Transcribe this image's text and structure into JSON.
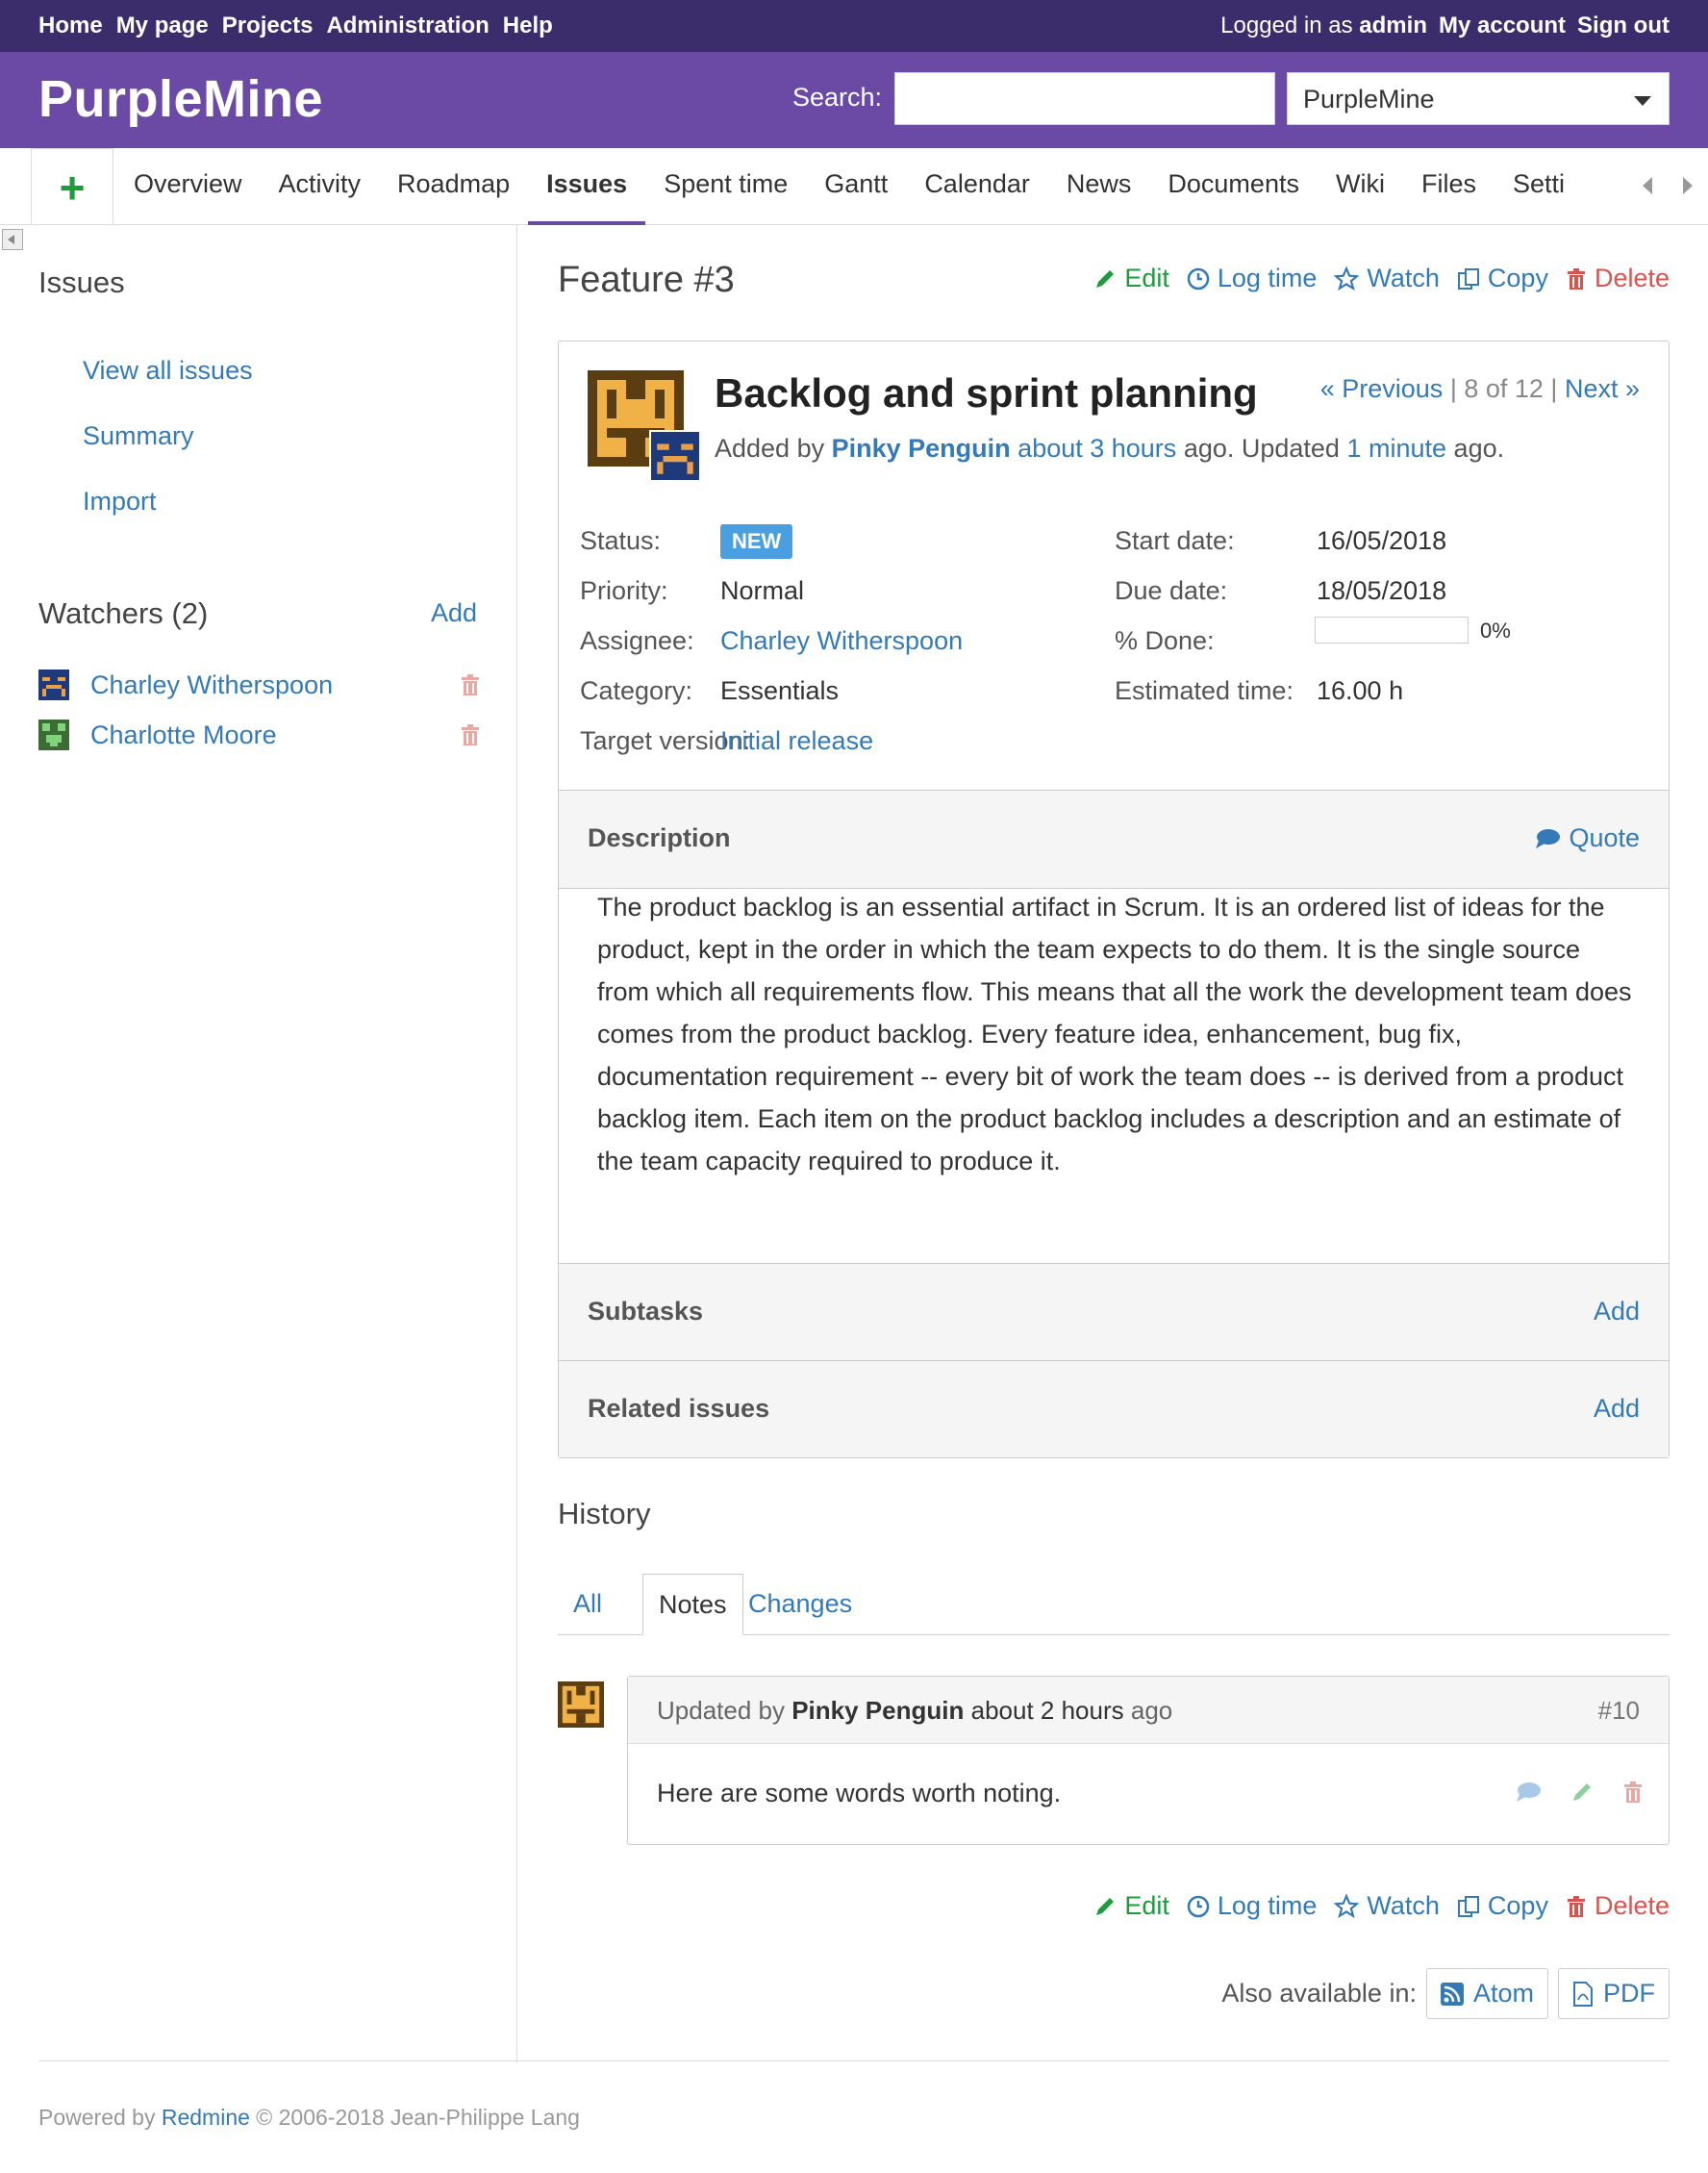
{
  "top_menu": {
    "items": [
      "Home",
      "My page",
      "Projects",
      "Administration",
      "Help"
    ],
    "logged_in_prefix": "Logged in as",
    "user": "admin",
    "my_account": "My account",
    "sign_out": "Sign out"
  },
  "header": {
    "title": "PurpleMine",
    "search_label": "Search:",
    "search_value": "",
    "project_select": "PurpleMine"
  },
  "main_menu": {
    "new_object": "+",
    "tabs": [
      "Overview",
      "Activity",
      "Roadmap",
      "Issues",
      "Spent time",
      "Gantt",
      "Calendar",
      "News",
      "Documents",
      "Wiki",
      "Files",
      "Setti"
    ],
    "selected": "Issues"
  },
  "sidebar": {
    "issues_heading": "Issues",
    "links": [
      "View all issues",
      "Summary",
      "Import"
    ],
    "watchers_heading": "Watchers (2)",
    "watchers_add": "Add",
    "watchers": [
      "Charley Witherspoon",
      "Charlotte Moore"
    ]
  },
  "issue": {
    "page_title": "Feature #3",
    "actions": {
      "edit": "Edit",
      "log_time": "Log time",
      "watch": "Watch",
      "copy": "Copy",
      "delete": "Delete"
    },
    "subject": "Backlog and sprint planning",
    "nav": {
      "previous": "« Previous",
      "position": "8 of 12",
      "next": "Next »"
    },
    "author": {
      "added_by": "Added by",
      "name": "Pinky Penguin",
      "created": "about 3 hours",
      "middle": "ago. Updated",
      "updated": "1 minute",
      "suffix": "ago."
    },
    "attributes": {
      "status_label": "Status:",
      "status": "NEW",
      "priority_label": "Priority:",
      "priority": "Normal",
      "assignee_label": "Assignee:",
      "assignee": "Charley Witherspoon",
      "category_label": "Category:",
      "category": "Essentials",
      "target_label": "Target version:",
      "target": "Initial release",
      "start_label": "Start date:",
      "start": "16/05/2018",
      "due_label": "Due date:",
      "due": "18/05/2018",
      "done_label": "% Done:",
      "done": "0%",
      "done_fraction": 0,
      "estimated_label": "Estimated time:",
      "estimated": "16.00 h"
    },
    "description_title": "Description",
    "quote": "Quote",
    "description": "The product backlog is an essential artifact in Scrum. It is an ordered list of ideas for the product, kept in the order in which the team expects to do them. It is the single source from which all requirements flow. This means that all the work the development team does comes from the product backlog. Every feature idea, enhancement, bug fix, documentation requirement -- every bit of work the team does -- is derived from a product backlog item. Each item on the product backlog includes a description and an estimate of the team capacity required to produce it.",
    "subtasks_title": "Subtasks",
    "subtasks_add": "Add",
    "related_title": "Related issues",
    "related_add": "Add"
  },
  "history": {
    "title": "History",
    "tabs": [
      "All",
      "Notes",
      "Changes"
    ],
    "active_tab": "Notes",
    "journal": {
      "prefix": "Updated by",
      "author": "Pinky Penguin",
      "time": "about 2 hours",
      "ago": "ago",
      "number": "#10",
      "note": "Here are some words worth noting."
    }
  },
  "also_available": {
    "label": "Also available in:",
    "atom": "Atom",
    "pdf": "PDF"
  },
  "footer": {
    "prefix": "Powered by",
    "link": "Redmine",
    "suffix": "© 2006-2018 Jean-Philippe Lang"
  },
  "colors": {
    "top_bar": "#3b2d6b",
    "header": "#6a4aa4",
    "link": "#337ab7",
    "edit": "#1e9b3d",
    "delete": "#d9534f",
    "badge_new": "#4a9fe0"
  }
}
